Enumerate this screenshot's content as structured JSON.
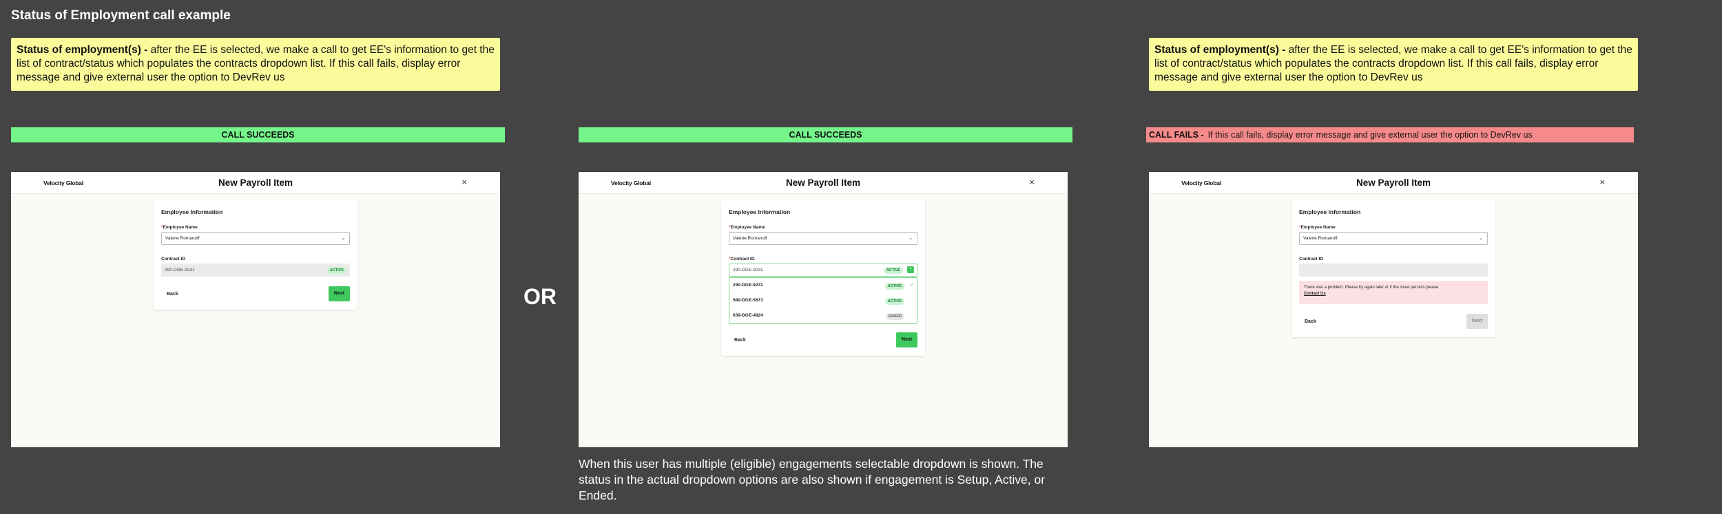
{
  "page_title": "Status of Employment call example",
  "note": {
    "bold": "Status of employment(s) -",
    "text": " after the EE is selected, we make a call to get EE's information to get the list of contract/status which populates the contracts dropdown list. If this call fails, display error message and give external user the option to DevRev us"
  },
  "banners": {
    "success": "CALL SUCCEEDS",
    "fail_bold": "CALL FAILS -",
    "fail_text": "If this call fails, display error message and give external user the option to DevRev us"
  },
  "or_label": "OR",
  "caption": "When this user has multiple (eligible) engagements selectable dropdown is shown. The status in the actual dropdown options are also shown if engagement is Setup, Active, or Ended.",
  "modal": {
    "logo": "Velocity Global",
    "title": "New Payroll Item",
    "close": "×",
    "card_title": "Employee Information",
    "employee_label": "Employee Name",
    "required_mark": "*",
    "employee_value": "Valerie Romanoff",
    "contract_label": "Contract ID",
    "contract_value": "290-DGE-9231",
    "back_label": "Back",
    "next_label": "Next"
  },
  "dropdown_options": [
    {
      "id": "290-DGE-9231",
      "status": "ACTIVE"
    },
    {
      "id": "580-DGE-5673",
      "status": "ACTIVE"
    },
    {
      "id": "639-DGE-4824",
      "status": "ENDED"
    }
  ],
  "error": {
    "message": "There was a problem. Please try again later or if the issue persists please",
    "link": "Contact Us"
  },
  "icons": {
    "chevron": "⌄",
    "check": "✓",
    "caret_up": "^"
  }
}
